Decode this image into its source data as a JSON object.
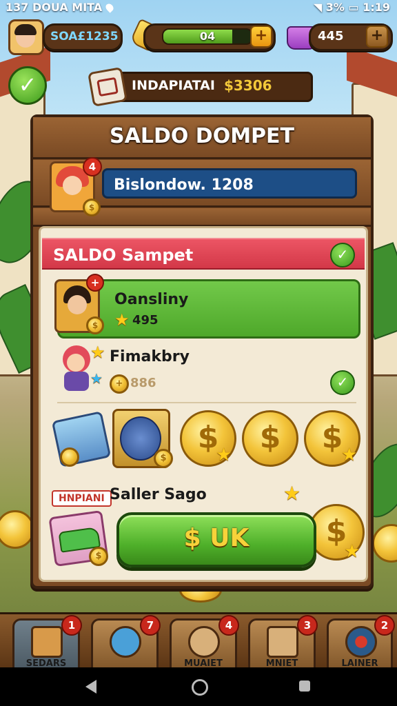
{
  "status_bar": {
    "left_text": "137 DOUA MITA",
    "battery": "3%",
    "time": "1:19"
  },
  "top_hud": {
    "player_currency": "SOA£1235",
    "energy_value": "04",
    "energy_fill": 0.78,
    "gems_value": "445"
  },
  "banner": {
    "label": "INDAPIATAI",
    "amount": "$3306"
  },
  "panel": {
    "title": "SALDO DOMPET",
    "hero_badge": "4",
    "balance_text": "Bislondow. 1208"
  },
  "sheet": {
    "header": "SALDO Sampet",
    "rows": [
      {
        "name": "Oansliny",
        "score": "495",
        "badge": "+"
      },
      {
        "name": "Fimakbry",
        "score": "886"
      }
    ],
    "tag_label": "HNPIANI",
    "seller_label": "Saller Sago",
    "ok_button": "$ UK"
  },
  "bottom_nav": [
    {
      "label": "SEDARS",
      "badge": "1",
      "icon": "house-icon"
    },
    {
      "label": "",
      "badge": "7",
      "icon": "magnifier-icon"
    },
    {
      "label": "MUAIET",
      "badge": "4",
      "icon": "coin-icon"
    },
    {
      "label": "MNIET",
      "badge": "3",
      "icon": "lock-icon"
    },
    {
      "label": "LAINER",
      "badge": "2",
      "icon": "target-icon"
    }
  ],
  "colors": {
    "accent_green": "#4ea82a",
    "header_red": "#d33848",
    "wood_brown": "#7a4a24",
    "balance_blue": "#1d4e86"
  }
}
